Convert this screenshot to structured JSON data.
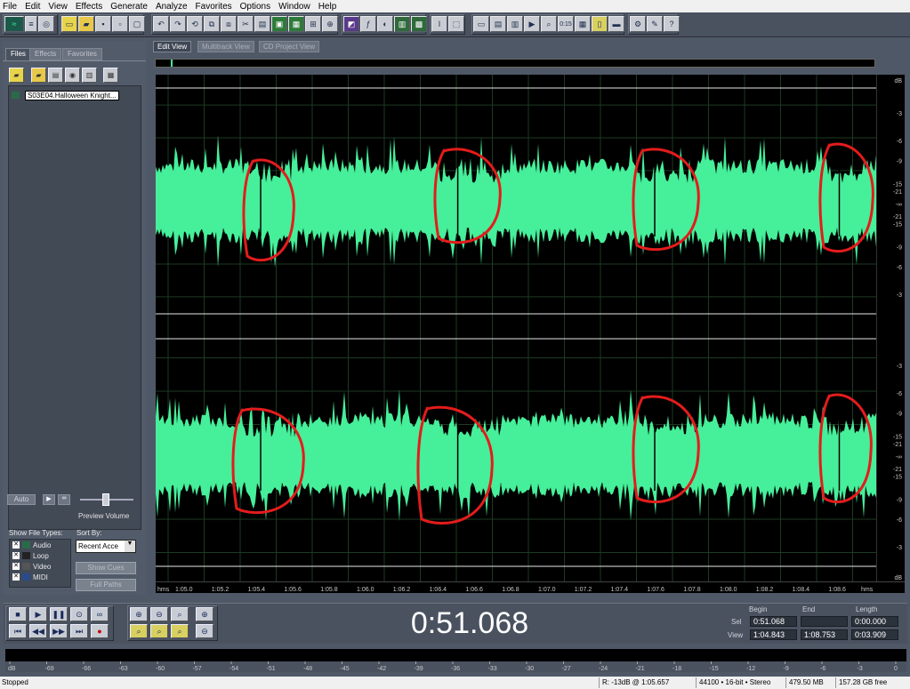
{
  "menu": [
    "File",
    "Edit",
    "View",
    "Effects",
    "Generate",
    "Analyze",
    "Favorites",
    "Options",
    "Window",
    "Help"
  ],
  "left_tabs": [
    "Files",
    "Effects",
    "Favorites"
  ],
  "file_item": "S03E04.Halloween Knight...",
  "auto_label": "Auto",
  "preview_volume_label": "Preview Volume",
  "show_file_types_label": "Show File Types:",
  "sort_by_label": "Sort By:",
  "file_types": [
    "Audio",
    "Loop",
    "Video",
    "MIDI"
  ],
  "sort_value": "Recent Acce",
  "show_cues_label": "Show Cues",
  "full_paths_label": "Full Paths",
  "edit_tabs": [
    "Edit View",
    "Multitrack View",
    "CD Project View"
  ],
  "db_scale": [
    "dB",
    "-3",
    "-6",
    "-9",
    "-15",
    "-21",
    "-∞",
    "-21",
    "-15",
    "-9",
    "-6",
    "-3"
  ],
  "db_unit_bottom": "dB",
  "time_ticks": [
    "hms",
    "1:05.0",
    "1:05.2",
    "1:05.4",
    "1:05.6",
    "1:05.8",
    "1:06.0",
    "1:06.2",
    "1:06.4",
    "1:06.6",
    "1:06.8",
    "1:07.0",
    "1:07.2",
    "1:07.4",
    "1:07.6",
    "1:07.8",
    "1:08.0",
    "1:08.2",
    "1:08.4",
    "1:08.6",
    "hms"
  ],
  "time_display": "0:51.068",
  "selection": {
    "col_begin": "Begin",
    "col_end": "End",
    "col_length": "Length",
    "sel_label": "Sel",
    "view_label": "View",
    "sel_begin": "0:51.068",
    "sel_end": "",
    "sel_length": "0:00.000",
    "view_begin": "1:04.843",
    "view_end": "1:08.753",
    "view_length": "0:03.909"
  },
  "meter_scale": [
    "dB",
    "-69",
    "-66",
    "-63",
    "-60",
    "-57",
    "-54",
    "-51",
    "-48",
    "-45",
    "-42",
    "-39",
    "-36",
    "-33",
    "-30",
    "-27",
    "-24",
    "-21",
    "-18",
    "-15",
    "-12",
    "-9",
    "-6",
    "-3",
    "0"
  ],
  "status": {
    "state": "Stopped",
    "cursor": "R: -13dB @ 1:05.657",
    "format": "44100 • 16-bit • Stereo",
    "size": "479.50 MB",
    "free": "157.28 GB free"
  },
  "colors": {
    "waveform": "#46ef9a",
    "annotation": "#e31c1c",
    "wave_bg": "#000000"
  }
}
